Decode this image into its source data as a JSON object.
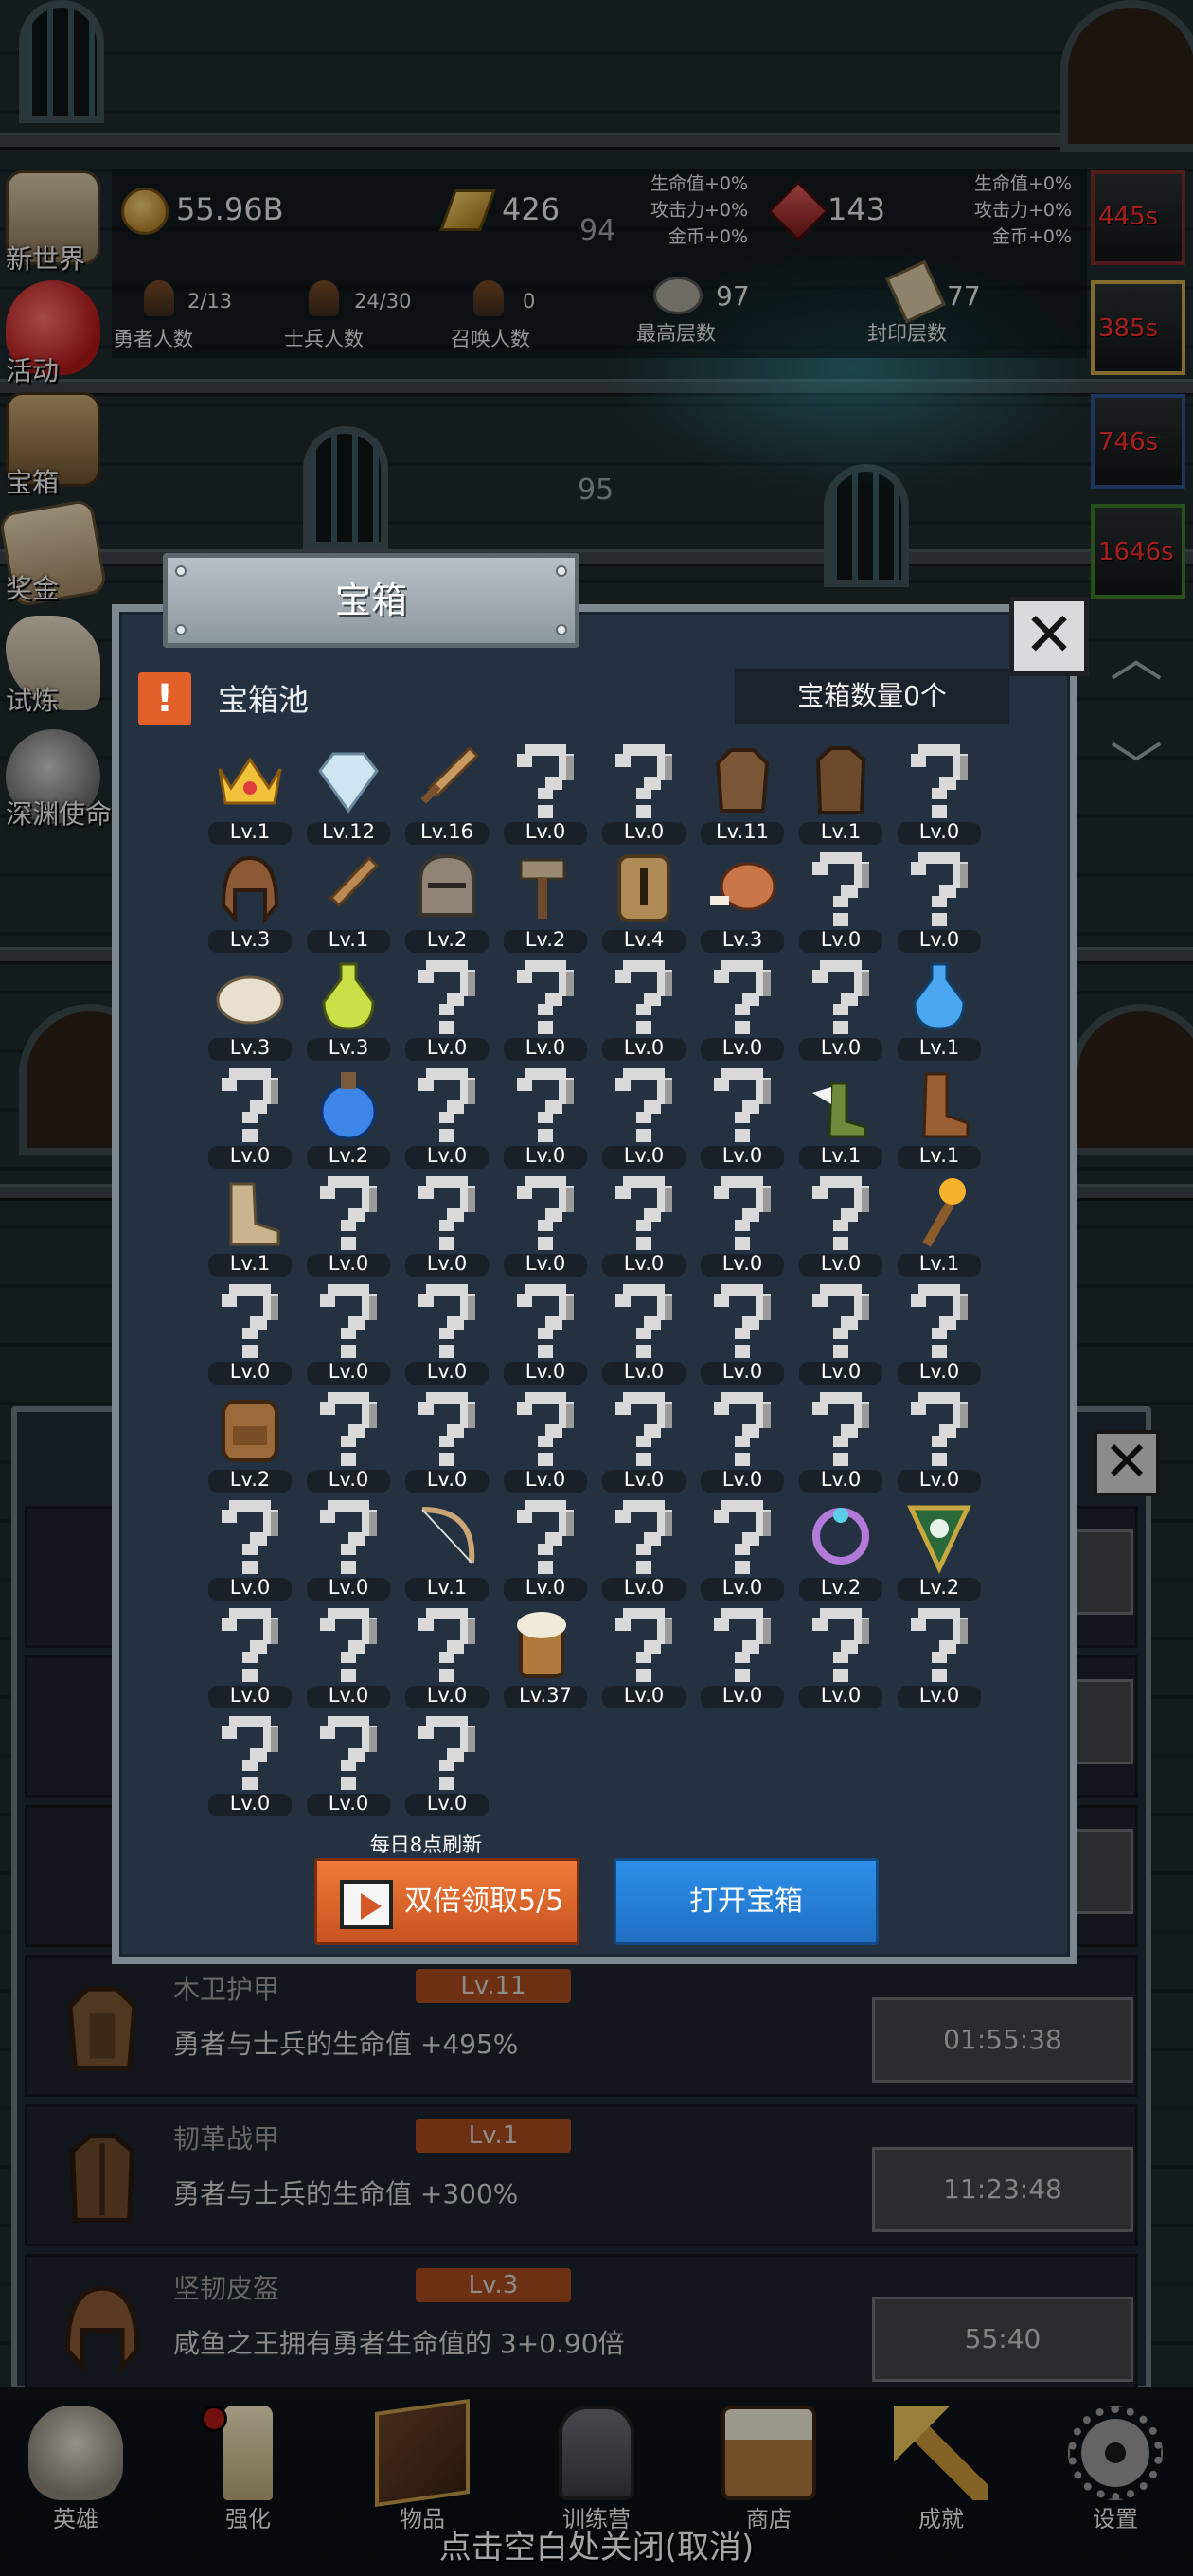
{
  "hud": {
    "gold": "55.96B",
    "gold_bars": "426",
    "gems": "143",
    "floor_top": "94",
    "floor_mid": "95",
    "left_bonus": [
      "生命值+0%",
      "攻击力+0%",
      "金币+0%"
    ],
    "right_bonus": [
      "生命值+0%",
      "攻击力+0%",
      "金币+0%"
    ],
    "heroes_value": "2/13",
    "heroes_label": "勇者人数",
    "soldiers_value": "24/30",
    "soldiers_label": "士兵人数",
    "summon_value": "0",
    "summon_label": "召唤人数",
    "max_floor_value": "97",
    "max_floor_label": "最高层数",
    "seal_floor_value": "77",
    "seal_floor_label": "封印层数"
  },
  "side_menu": [
    "新世界",
    "活动",
    "宝箱",
    "奖金",
    "试炼",
    "深渊使命"
  ],
  "timers": [
    "445s",
    "385s",
    "746s",
    "1646s"
  ],
  "modal": {
    "title": "宝箱",
    "pool_icon": "!",
    "pool_label": "宝箱池",
    "count_label": "宝箱数量0个",
    "refresh_note": "每日8点刷新",
    "double_button": "双倍领取5/5",
    "open_button": "打开宝箱",
    "close_icon": "✕"
  },
  "chest_items": [
    {
      "icon": "crown",
      "lv": "Lv.1"
    },
    {
      "icon": "diamond",
      "lv": "Lv.12"
    },
    {
      "icon": "sword",
      "lv": "Lv.16"
    },
    {
      "icon": "unknown",
      "lv": "Lv.0"
    },
    {
      "icon": "unknown",
      "lv": "Lv.0"
    },
    {
      "icon": "wood-armor",
      "lv": "Lv.11"
    },
    {
      "icon": "leather-armor",
      "lv": "Lv.1"
    },
    {
      "icon": "unknown",
      "lv": "Lv.0"
    },
    {
      "icon": "leather-helm",
      "lv": "Lv.3"
    },
    {
      "icon": "wood-sword",
      "lv": "Lv.1"
    },
    {
      "icon": "iron-helm",
      "lv": "Lv.2"
    },
    {
      "icon": "hammer",
      "lv": "Lv.2"
    },
    {
      "icon": "great-helm",
      "lv": "Lv.4"
    },
    {
      "icon": "meat",
      "lv": "Lv.3"
    },
    {
      "icon": "unknown",
      "lv": "Lv.0"
    },
    {
      "icon": "unknown",
      "lv": "Lv.0"
    },
    {
      "icon": "bun",
      "lv": "Lv.3"
    },
    {
      "icon": "green-potion",
      "lv": "Lv.3"
    },
    {
      "icon": "unknown",
      "lv": "Lv.0"
    },
    {
      "icon": "unknown",
      "lv": "Lv.0"
    },
    {
      "icon": "unknown",
      "lv": "Lv.0"
    },
    {
      "icon": "unknown",
      "lv": "Lv.0"
    },
    {
      "icon": "unknown",
      "lv": "Lv.0"
    },
    {
      "icon": "blue-potion",
      "lv": "Lv.1"
    },
    {
      "icon": "unknown",
      "lv": "Lv.0"
    },
    {
      "icon": "big-blue-potion",
      "lv": "Lv.2"
    },
    {
      "icon": "unknown",
      "lv": "Lv.0"
    },
    {
      "icon": "unknown",
      "lv": "Lv.0"
    },
    {
      "icon": "unknown",
      "lv": "Lv.0"
    },
    {
      "icon": "unknown",
      "lv": "Lv.0"
    },
    {
      "icon": "winged-boot",
      "lv": "Lv.1"
    },
    {
      "icon": "leather-boot",
      "lv": "Lv.1"
    },
    {
      "icon": "cloth-boot",
      "lv": "Lv.1"
    },
    {
      "icon": "unknown",
      "lv": "Lv.0"
    },
    {
      "icon": "unknown",
      "lv": "Lv.0"
    },
    {
      "icon": "unknown",
      "lv": "Lv.0"
    },
    {
      "icon": "unknown",
      "lv": "Lv.0"
    },
    {
      "icon": "unknown",
      "lv": "Lv.0"
    },
    {
      "icon": "unknown",
      "lv": "Lv.0"
    },
    {
      "icon": "torch",
      "lv": "Lv.1"
    },
    {
      "icon": "unknown",
      "lv": "Lv.0"
    },
    {
      "icon": "unknown",
      "lv": "Lv.0"
    },
    {
      "icon": "unknown",
      "lv": "Lv.0"
    },
    {
      "icon": "unknown",
      "lv": "Lv.0"
    },
    {
      "icon": "unknown",
      "lv": "Lv.0"
    },
    {
      "icon": "unknown",
      "lv": "Lv.0"
    },
    {
      "icon": "unknown",
      "lv": "Lv.0"
    },
    {
      "icon": "unknown",
      "lv": "Lv.0"
    },
    {
      "icon": "backpack",
      "lv": "Lv.2"
    },
    {
      "icon": "unknown",
      "lv": "Lv.0"
    },
    {
      "icon": "unknown",
      "lv": "Lv.0"
    },
    {
      "icon": "unknown",
      "lv": "Lv.0"
    },
    {
      "icon": "unknown",
      "lv": "Lv.0"
    },
    {
      "icon": "unknown",
      "lv": "Lv.0"
    },
    {
      "icon": "unknown",
      "lv": "Lv.0"
    },
    {
      "icon": "unknown",
      "lv": "Lv.0"
    },
    {
      "icon": "unknown",
      "lv": "Lv.0"
    },
    {
      "icon": "unknown",
      "lv": "Lv.0"
    },
    {
      "icon": "bow",
      "lv": "Lv.1"
    },
    {
      "icon": "unknown",
      "lv": "Lv.0"
    },
    {
      "icon": "unknown",
      "lv": "Lv.0"
    },
    {
      "icon": "unknown",
      "lv": "Lv.0"
    },
    {
      "icon": "gem-ring",
      "lv": "Lv.2"
    },
    {
      "icon": "amulet",
      "lv": "Lv.2"
    },
    {
      "icon": "unknown",
      "lv": "Lv.0"
    },
    {
      "icon": "unknown",
      "lv": "Lv.0"
    },
    {
      "icon": "unknown",
      "lv": "Lv.0"
    },
    {
      "icon": "beer",
      "lv": "Lv.37"
    },
    {
      "icon": "unknown",
      "lv": "Lv.0"
    },
    {
      "icon": "unknown",
      "lv": "Lv.0"
    },
    {
      "icon": "unknown",
      "lv": "Lv.0"
    },
    {
      "icon": "unknown",
      "lv": "Lv.0"
    },
    {
      "icon": "unknown",
      "lv": "Lv.0"
    },
    {
      "icon": "unknown",
      "lv": "Lv.0"
    },
    {
      "icon": "unknown",
      "lv": "Lv.0"
    }
  ],
  "back_rows": [
    {
      "name": "木卫护甲",
      "lv": "Lv.11",
      "desc": "勇者与士兵的生命值 +495%",
      "timer": "01:55:38",
      "icon": "wood-armor"
    },
    {
      "name": "韧革战甲",
      "lv": "Lv.1",
      "desc": "勇者与士兵的生命值 +300%",
      "timer": "11:23:48",
      "icon": "leather-armor"
    },
    {
      "name": "坚韧皮盔",
      "lv": "Lv.3",
      "desc": "咸鱼之王拥有勇者生命值的 3+0.90倍",
      "timer": "55:40",
      "icon": "leather-helm"
    }
  ],
  "bottom_nav": [
    "英雄",
    "强化",
    "物品",
    "训练营",
    "商店",
    "成就",
    "设置"
  ],
  "bottom_hint": "点击空白处关闭(取消)"
}
